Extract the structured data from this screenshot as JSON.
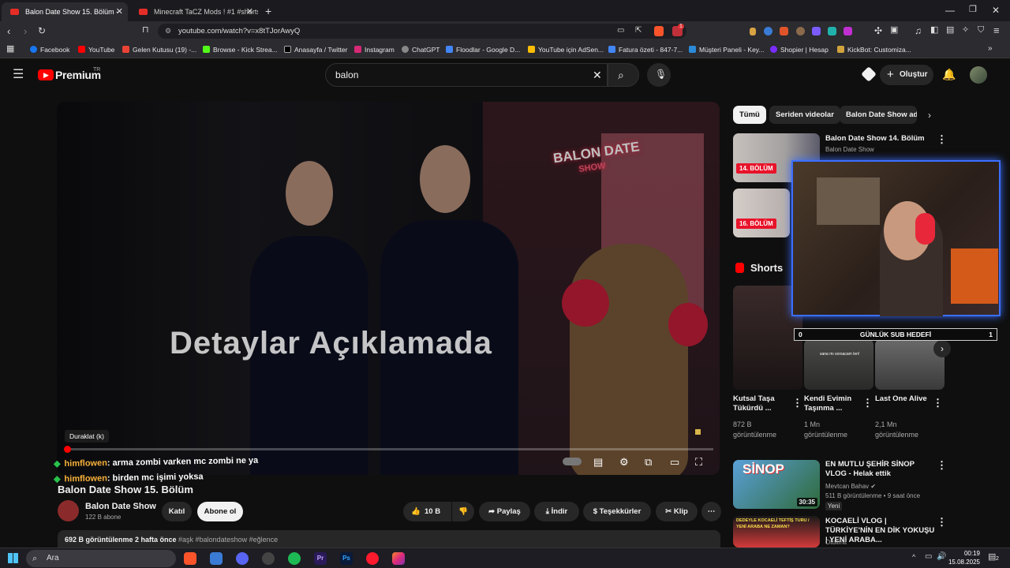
{
  "browser": {
    "tabs": [
      {
        "label": "Balon Date Show 15. Bölüm -",
        "active": true
      },
      {
        "label": "Minecraft TaCZ Mods ! #1 #shorts #",
        "active": false
      }
    ],
    "url": "youtube.com/watch?v=x8tTJorAwyQ",
    "extension_badge": "1",
    "bookmarks": [
      "Facebook",
      "YouTube",
      "Gelen Kutusu (19) -...",
      "Browse - Kick Strea...",
      "Anasayfa / Twitter",
      "Instagram",
      "ChatGPT",
      "Floodlar - Google D...",
      "YouTube için AdSen...",
      "Fatura özeti - 847-7...",
      "Müşteri Paneli - Key...",
      "Shopier | Hesap",
      "KickBot: Customiza..."
    ]
  },
  "youtube": {
    "logo": "Premium",
    "logo_sup": "TR",
    "search_value": "balon",
    "create_label": "Oluştur"
  },
  "player": {
    "sign_line1": "BALON DATE",
    "sign_line2": "SHOW",
    "overlay_text": "Detaylar Açıklamada",
    "tooltip": "Duraklat (k)",
    "progress": 0.0,
    "chat": [
      {
        "user": "himflowen",
        "message": ": arma zombi varken mc zombi ne ya"
      },
      {
        "user": "himflowen",
        "message": ": birden mc işimi yoksa"
      }
    ]
  },
  "video": {
    "title": "Balon Date Show 15. Bölüm",
    "channel": "Balon Date Show",
    "subscribers": "122 B abone",
    "join_label": "Katıl",
    "subscribe_label": "Abone ol",
    "likes": "10 B",
    "share_label": "Paylaş",
    "download_label": "İndir",
    "thanks_label": "Teşekkürler",
    "clip_label": "Klip",
    "description_meta": "692 B görüntülenme  2 hafta önce",
    "description_tags": "#aşk #balondateshow #eğlence"
  },
  "sidebar": {
    "chips": [
      "Tümü",
      "Seriden videolar",
      "Balon Date Show adlı"
    ],
    "rec1": {
      "title": "Balon Date Show 14. Bölüm",
      "channel": "Balon Date Show",
      "badge": "14. BÖLÜM"
    },
    "rec2": {
      "badge": "16. BÖLÜM"
    },
    "shorts_heading": "Shorts",
    "shorts": [
      {
        "title": "Kutsal Taşa Tükürdü ...",
        "views": "872 B görüntülenme"
      },
      {
        "title": "Kendi Evimin Taşınma ...",
        "views": "1 Mn görüntülenme"
      },
      {
        "title": "Last One Alive",
        "views": "2,1 Mn görüntülenme"
      }
    ],
    "short2_caption": "sana mı sorsacam len!",
    "rec3": {
      "title": "EN MUTLU ŞEHİR SİNOP VLOG - Helak ettik",
      "channel": "Mevtcan Bahav",
      "meta": "511 B görüntülenme • 9 saat önce",
      "badge": "Yeni",
      "duration": "30:35",
      "thumb_text": "SİNOP"
    },
    "rec4": {
      "title": "KOCAELİ VLOG | TÜRKİYE'NİN EN DİK YOKUŞU | YENİ ARABA...",
      "channel": "Otolimit",
      "thumb_text": "DEDEYLE KOCAELİ TEFTİŞ TURU / YENİ ARABA NE ZAMAN?"
    }
  },
  "stream_overlay": {
    "goal_label": "GÜNLÜK SUB HEDEFİ",
    "goal_current": "0",
    "goal_target": "1"
  },
  "taskbar": {
    "search_placeholder": "Ara",
    "time": "00:19",
    "date": "15.08.2025",
    "notif_count": "2"
  }
}
